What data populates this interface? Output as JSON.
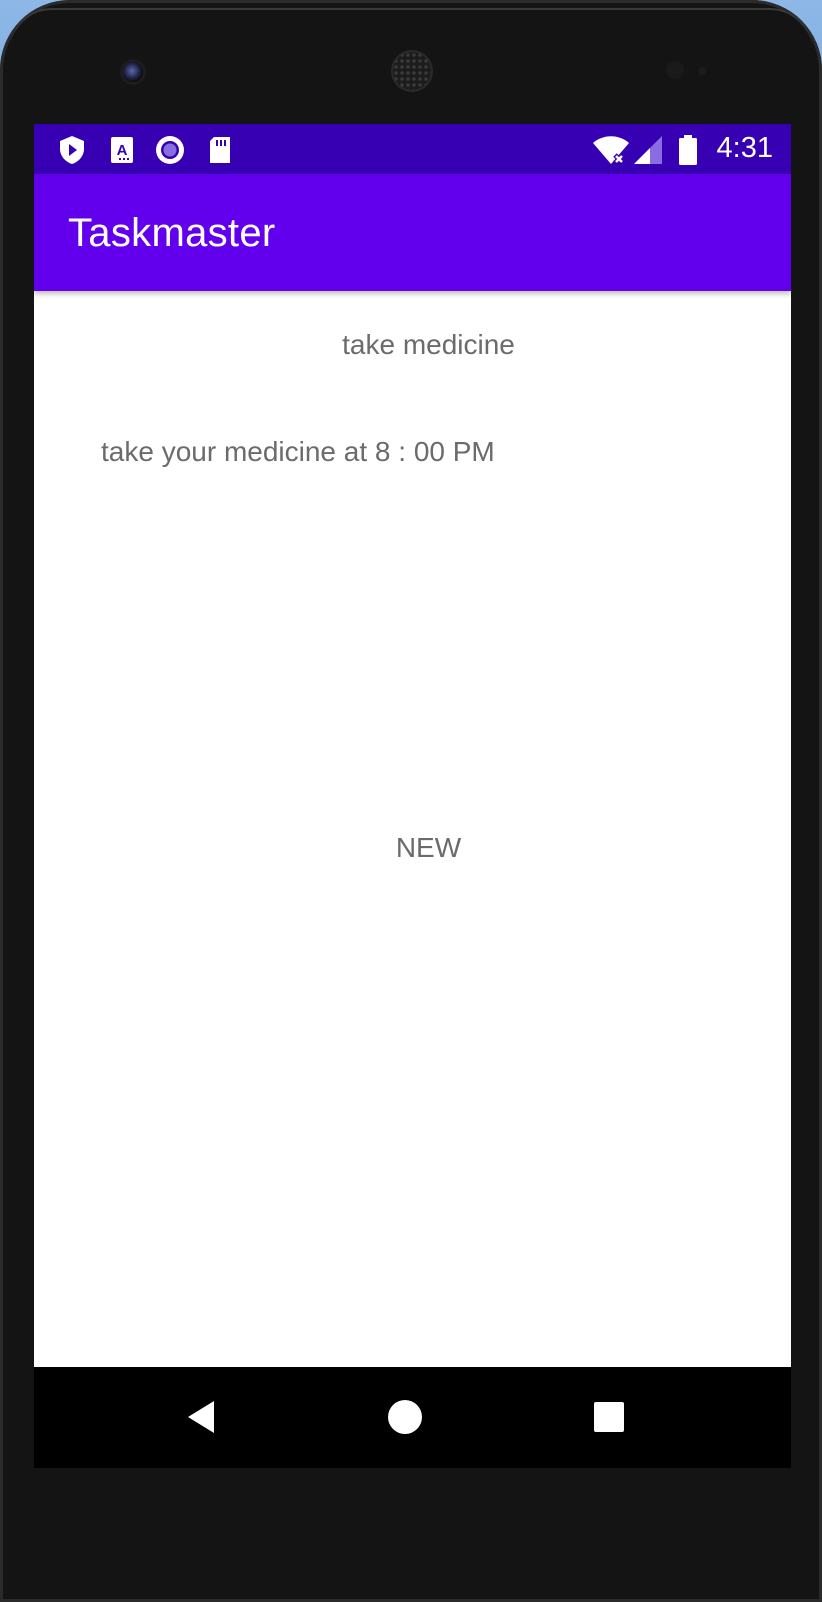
{
  "status_bar": {
    "time": "4:31",
    "left_icons": [
      "play-protect-icon",
      "autofill-a-icon",
      "record-circle-icon",
      "sd-card-icon"
    ],
    "right_icons": [
      "wifi-no-internet-icon",
      "cell-signal-icon",
      "battery-icon"
    ],
    "background": "#3700b3"
  },
  "app_bar": {
    "title": "Taskmaster",
    "background": "#6200ee"
  },
  "task": {
    "title": "take medicine",
    "body": "take your medicine at 8 : 00 PM",
    "state": "NEW"
  },
  "nav_bar": {
    "buttons": [
      "back-icon",
      "home-icon",
      "recents-icon"
    ]
  }
}
